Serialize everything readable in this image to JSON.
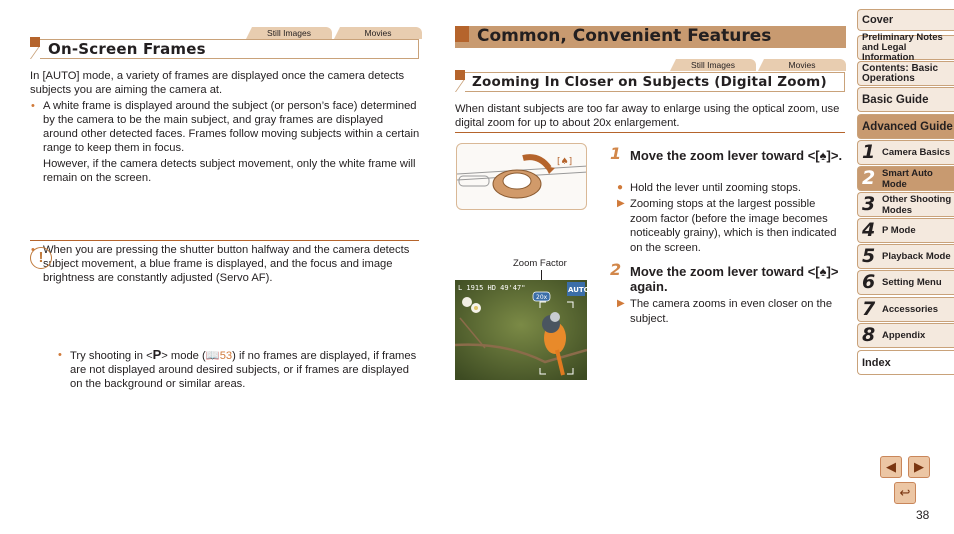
{
  "left": {
    "tabs": {
      "still": "Still Images",
      "movies": "Movies"
    },
    "section_title": "On-Screen Frames",
    "intro": "In [AUTO] mode, a variety of frames are displayed once the camera detects subjects you are aiming the camera at.",
    "bullets": [
      {
        "text": "A white frame is displayed around the subject (or person’s face) determined by the camera to be the main subject, and gray frames are displayed around other detected faces. Frames follow moving subjects within a certain range to keep them in focus.",
        "extra": "However, if the camera detects subject movement, only the white frame will remain on the screen."
      },
      {
        "text": "When you are pressing the shutter button halfway and the camera detects subject movement, a blue frame is displayed, and the focus and image brightness are constantly adjusted (Servo AF)."
      }
    ],
    "caution": {
      "icon": "caution-icon",
      "pre": "Try shooting in <",
      "mode": "P",
      "mid": "> mode (",
      "page_ref": "53",
      "post": ") if no frames are displayed, if frames are not displayed around desired subjects, or if frames are displayed on the background or similar areas."
    }
  },
  "right": {
    "chapter_title": "Common, Convenient Features",
    "tabs": {
      "still": "Still Images",
      "movies": "Movies"
    },
    "section_title": "Zooming In Closer on Subjects (Digital Zoom)",
    "intro": "When distant subjects are too far away to enlarge using the optical zoom, use digital zoom for up to about 20x enlargement.",
    "figure_caption": "Zoom Factor",
    "steps": [
      {
        "num": "1",
        "title": "Move the zoom lever toward <[♠]>.",
        "items": [
          {
            "type": "dot",
            "text": "Hold the lever until zooming stops."
          },
          {
            "type": "arrow",
            "text": "Zooming stops at the largest possible zoom factor (before the image becomes noticeably grainy), which is then indicated on the screen."
          }
        ]
      },
      {
        "num": "2",
        "title": "Move the zoom lever toward <[♠]> again.",
        "items": [
          {
            "type": "arrow",
            "text": "The camera zooms in even closer on the subject."
          }
        ]
      }
    ],
    "screen_overlay": {
      "mode": "AUTO",
      "info": "L 1915 HD 49'47\"",
      "zoom": "20x"
    }
  },
  "sidebar": {
    "items": [
      {
        "label": "Cover"
      },
      {
        "label": "Preliminary Notes and Legal Information"
      },
      {
        "label": "Contents: Basic Operations"
      },
      {
        "label": "Basic Guide"
      },
      {
        "label": "Advanced Guide",
        "active": true
      }
    ],
    "chapters": [
      {
        "num": "1",
        "label": "Camera Basics"
      },
      {
        "num": "2",
        "label": "Smart Auto Mode",
        "active": true
      },
      {
        "num": "3",
        "label": "Other Shooting Modes"
      },
      {
        "num": "4",
        "label": "P Mode"
      },
      {
        "num": "5",
        "label": "Playback Mode"
      },
      {
        "num": "6",
        "label": "Setting Menu"
      },
      {
        "num": "7",
        "label": "Accessories"
      },
      {
        "num": "8",
        "label": "Appendix"
      }
    ],
    "index": "Index"
  },
  "nav": {
    "prev": "◀",
    "next": "▶",
    "back": "↩"
  },
  "page_number": "38"
}
